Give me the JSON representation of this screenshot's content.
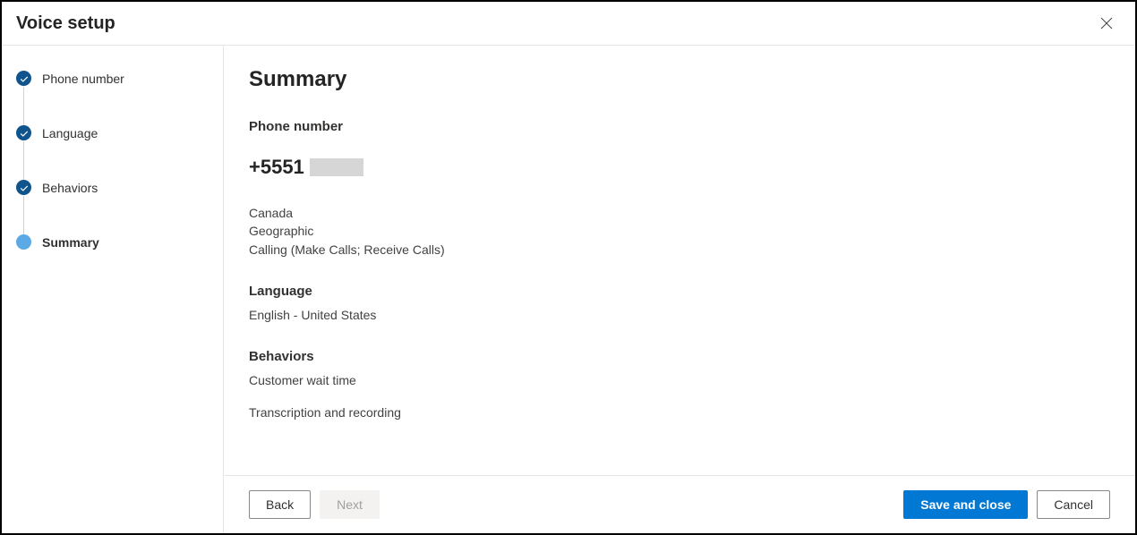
{
  "header": {
    "title": "Voice setup"
  },
  "sidebar": {
    "steps": [
      {
        "label": "Phone number",
        "state": "completed"
      },
      {
        "label": "Language",
        "state": "completed"
      },
      {
        "label": "Behaviors",
        "state": "completed"
      },
      {
        "label": "Summary",
        "state": "current"
      }
    ]
  },
  "main": {
    "title": "Summary",
    "phone": {
      "heading": "Phone number",
      "value": "+5551",
      "country": "Canada",
      "type": "Geographic",
      "capabilities": "Calling (Make Calls; Receive Calls)"
    },
    "language": {
      "heading": "Language",
      "value": "English - United States"
    },
    "behaviors": {
      "heading": "Behaviors",
      "items": [
        "Customer wait time",
        "Transcription and recording"
      ]
    }
  },
  "footer": {
    "back": "Back",
    "next": "Next",
    "save": "Save and close",
    "cancel": "Cancel"
  }
}
